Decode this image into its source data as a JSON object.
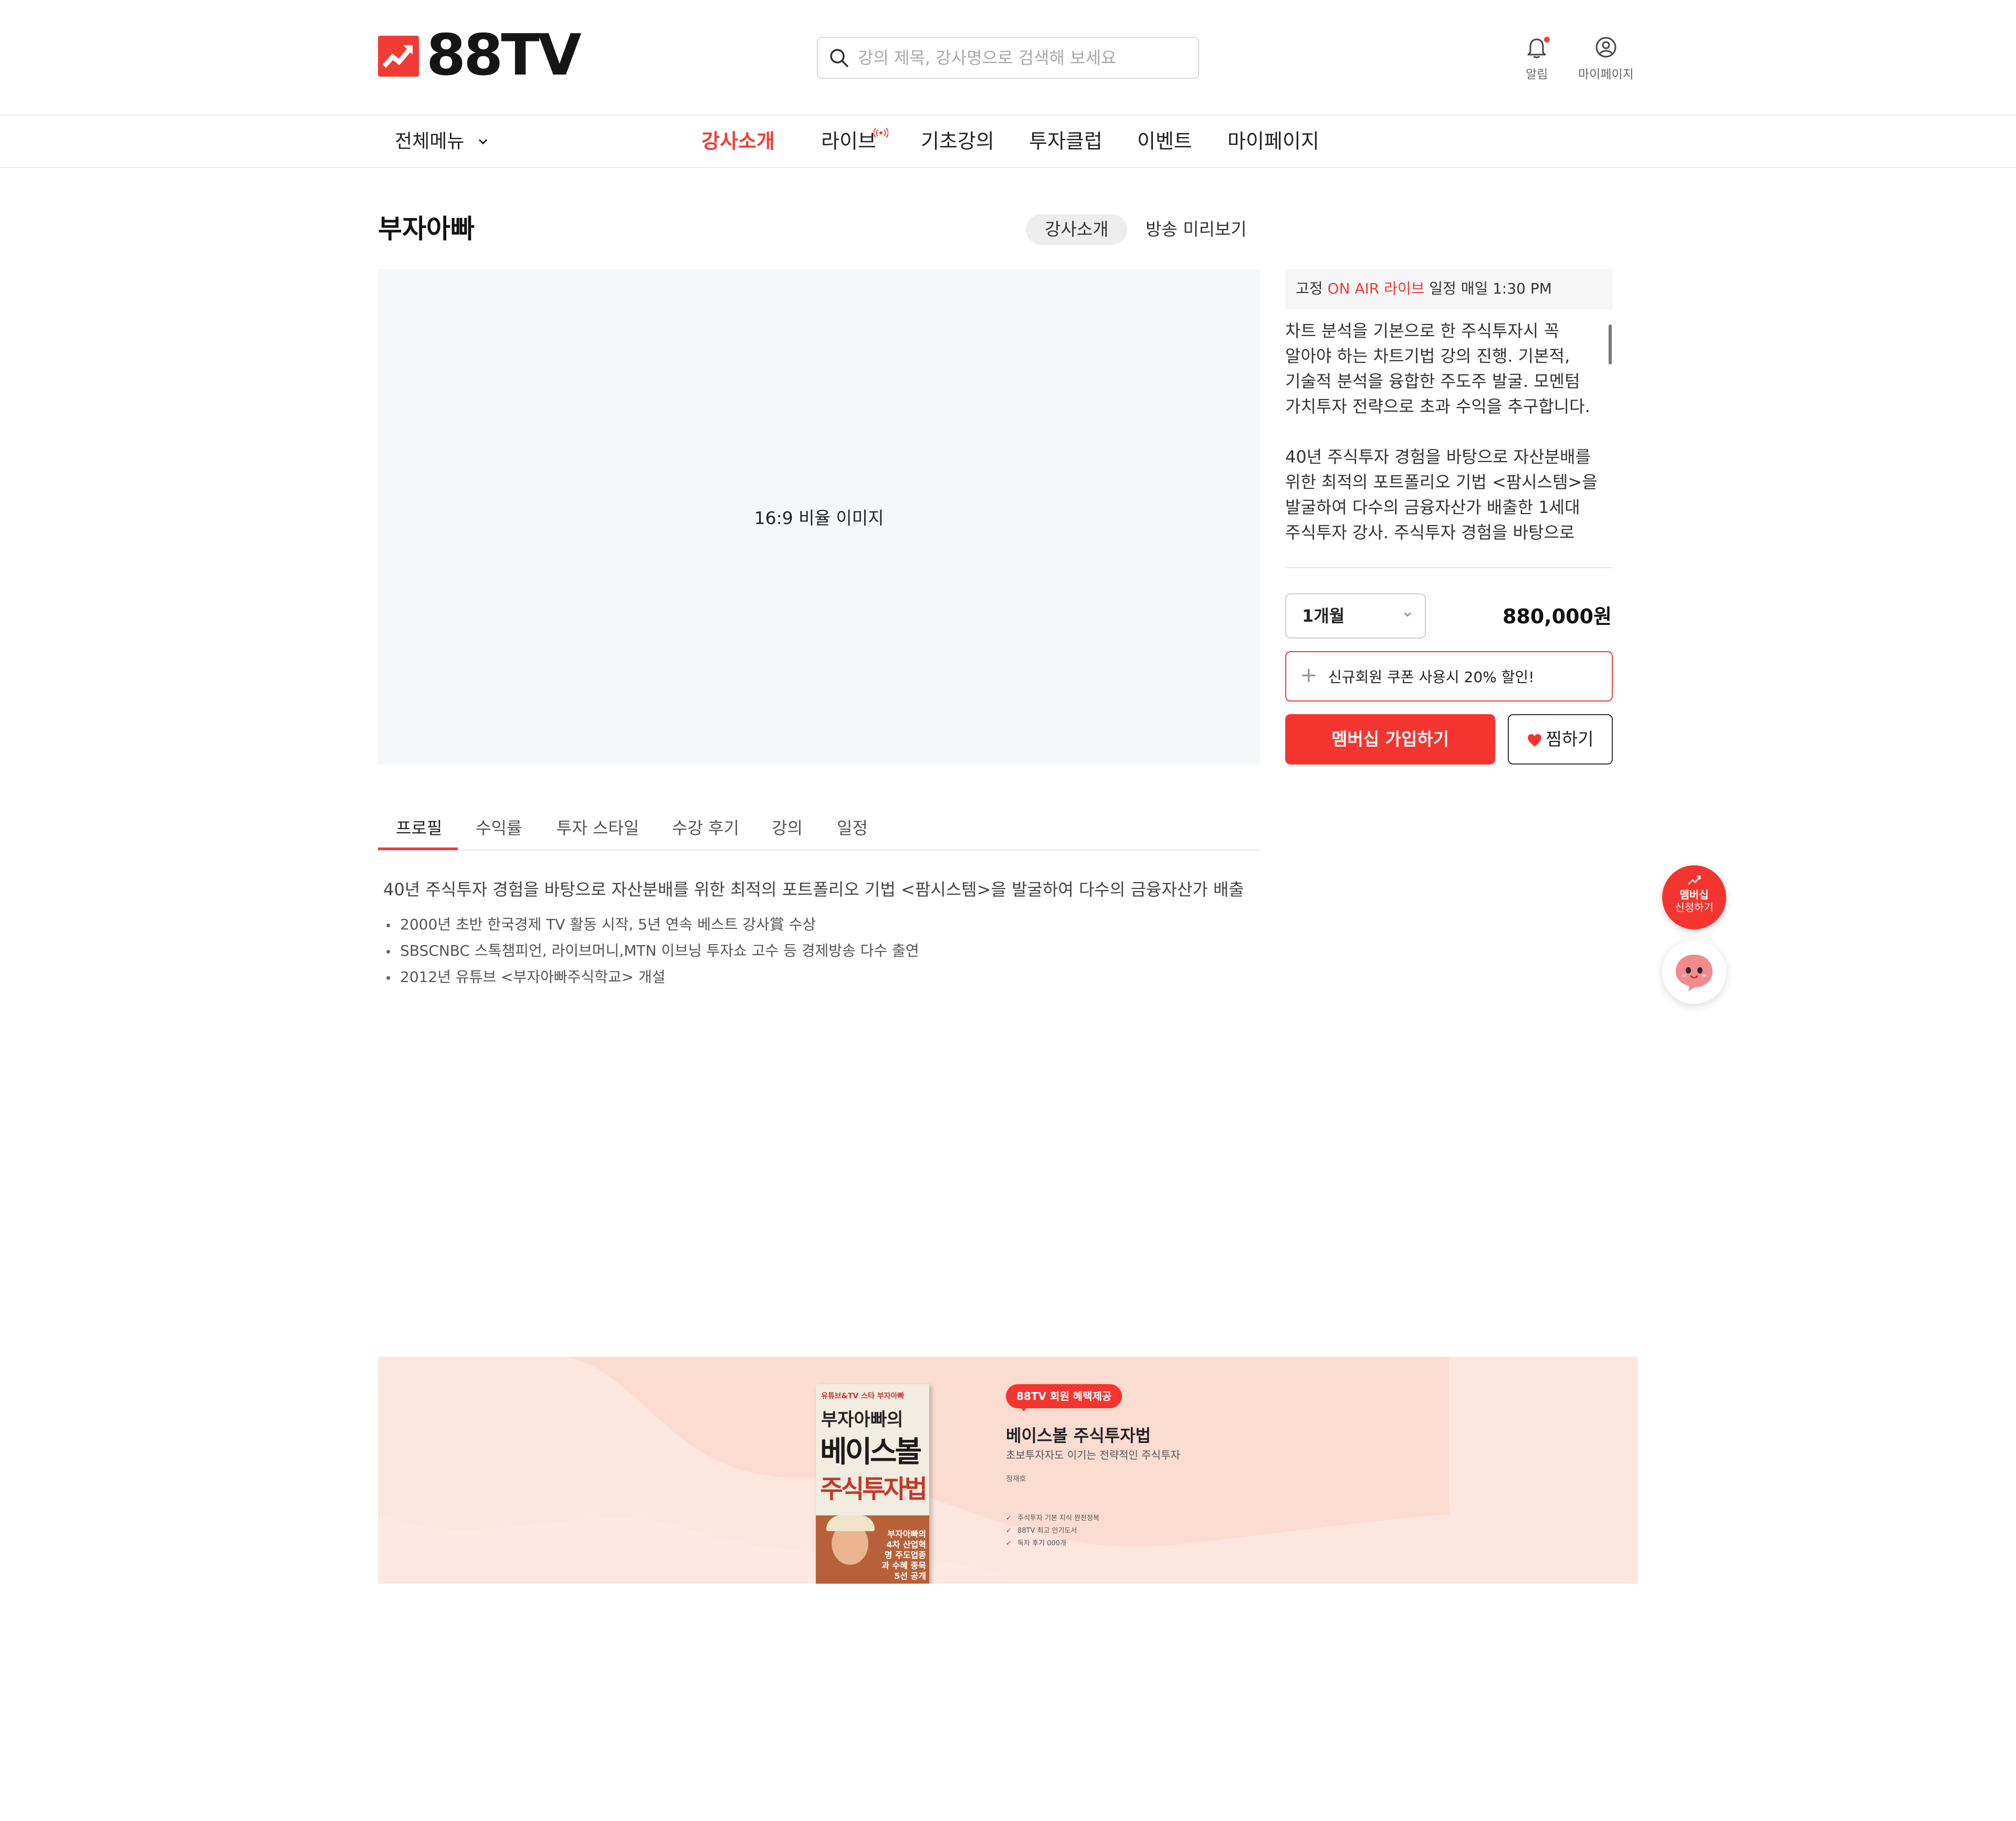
{
  "header": {
    "logo_text": "88TV",
    "search_placeholder": "강의 제목, 강사명으로 검색해 보세요",
    "notifications_label": "알림",
    "mypage_label": "마이페이지"
  },
  "nav": {
    "all_menu": "전체메뉴",
    "items": [
      {
        "label": "강사소개",
        "active": true
      },
      {
        "label": "라이브",
        "active": false
      },
      {
        "label": "기초강의",
        "active": false
      },
      {
        "label": "투자클럽",
        "active": false
      },
      {
        "label": "이벤트",
        "active": false
      },
      {
        "label": "마이페이지",
        "active": false
      }
    ]
  },
  "page": {
    "title": "부자아빠",
    "segments": [
      "강사소개",
      "방송 미리보기"
    ],
    "hero_caption": "16:9 비율 이미지"
  },
  "schedule": {
    "prefix": "고정",
    "on_air": "ON AIR 라이브",
    "suffix": "일정 매일 1:30 PM"
  },
  "description": "차트 분석을 기본으로 한 주식투자시 꼭 알아야 하는 차트기법 강의 진행. 기본적, 기술적 분석을 융합한 주도주 발굴. 모멘텀 가치투자 전략으로 초과 수익을 추구합니다.\n\n40년 주식투자 경험을 바탕으로 자산분배를 위한 최적의 포트폴리오 기법 <팜시스템>을 발굴하여 다수의 금융자산가 배출한 1세대 주식투자 강사. 주식투자 경험을 바탕으로 자산분배를",
  "purchase": {
    "period_selected": "1개월",
    "price": "880,000원",
    "coupon_text": "신규회원 쿠폰 사용시 20% 할인!",
    "join_button": "멤버십 가입하기",
    "wish_button": "찜하기"
  },
  "tabs": [
    "프로필",
    "수익률",
    "투자 스타일",
    "수강 후기",
    "강의",
    "일정"
  ],
  "profile": {
    "lead": "40년 주식투자 경험을 바탕으로 자산분배를 위한 최적의 포트폴리오 기법 <팜시스템>을 발굴하여 다수의 금융자산가 배출",
    "items": [
      "2000년 초반 한국경제 TV 활동 시작, 5년 연속 베스트 강사賞 수상",
      "SBSCNBC 스톡챔피언, 라이브머니,MTN 이브닝 투자쇼 고수 등 경제방송 다수 출연",
      "2012년 유튜브 <부자아빠주식학교> 개설"
    ]
  },
  "floating": {
    "member_line1": "멤버십",
    "member_line2": "신청하기"
  },
  "banner": {
    "badge": "88TV 회원 혜택제공",
    "title": "베이스볼 주식투자법",
    "subtitle": "초보투자자도 이기는 전략적인 주식투자",
    "author": "정재호",
    "benefits": [
      "주식투자 기본 지식 완전정복",
      "88TV 최고 인기도서",
      "독자 후기 000개"
    ],
    "book": {
      "top_line": "유튜브&TV 스타 부자아빠",
      "title_1": "부자아빠의",
      "title_2": "베이스볼",
      "title_3": "주식투자법",
      "photo_caption": "부자아빠의 4차 산업혁명 주도업종과 수혜 종목 5선 공개"
    }
  },
  "colors": {
    "brand_red": "#f23b35",
    "banner_bg": "#fce6de"
  }
}
